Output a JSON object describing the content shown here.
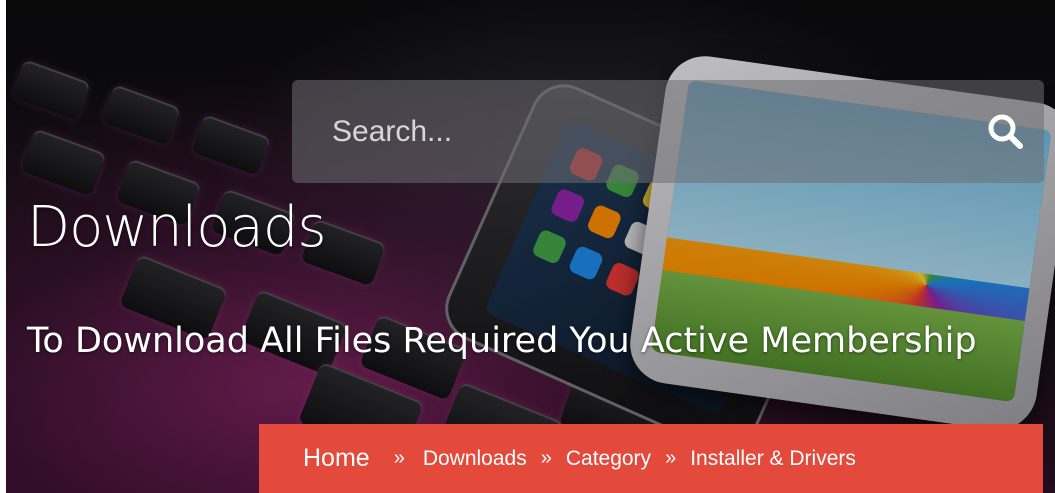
{
  "search": {
    "placeholder": "Search..."
  },
  "hero": {
    "title": "Downloads",
    "subtitle": "To Download All Files Required You Active Membership"
  },
  "breadcrumb": {
    "items": [
      "Home",
      "Downloads",
      "Category",
      "Installer & Drivers"
    ],
    "separator": "»",
    "background": "#e44a3b"
  },
  "icons": {
    "search": "search-icon",
    "separator": "double-chevron-right-icon"
  }
}
